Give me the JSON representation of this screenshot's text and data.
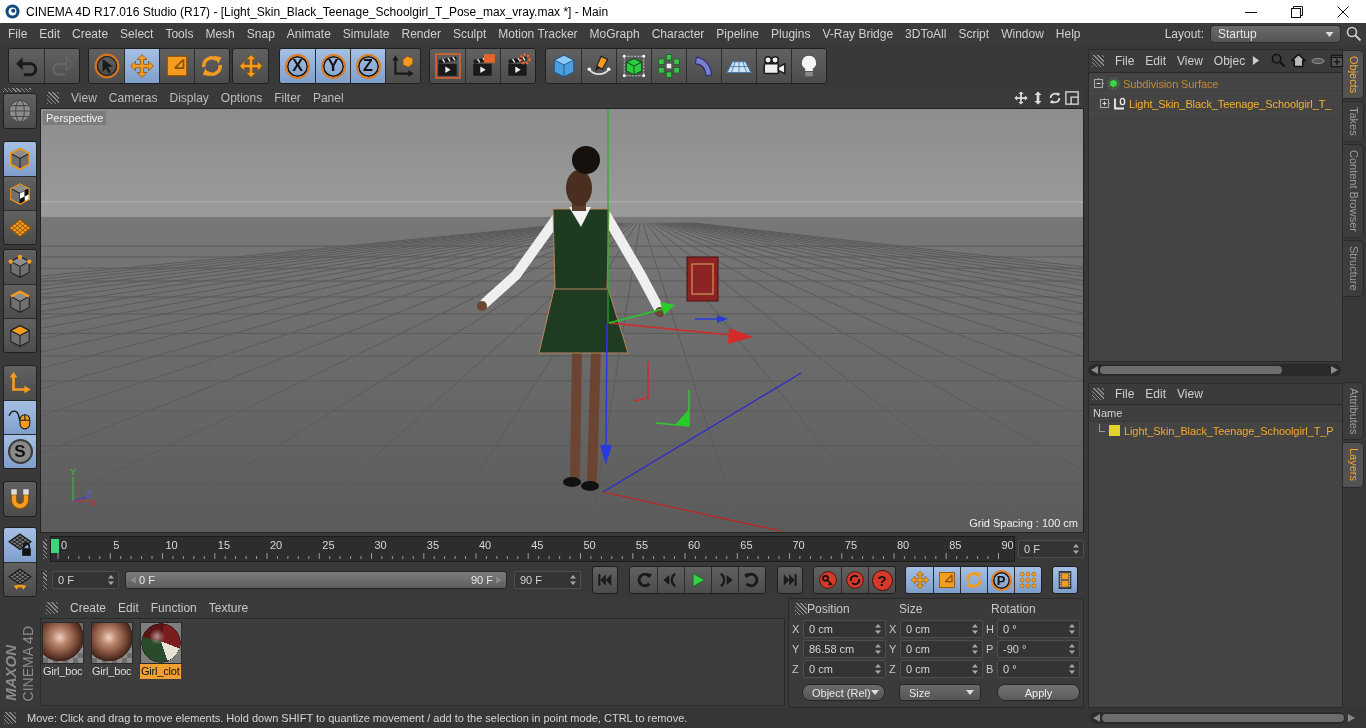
{
  "window": {
    "title": "CINEMA 4D R17.016 Studio (R17) - [Light_Skin_Black_Teenage_Schoolgirl_T_Pose_max_vray.max *] - Main"
  },
  "menu_bar": {
    "items": [
      "File",
      "Edit",
      "Create",
      "Select",
      "Tools",
      "Mesh",
      "Snap",
      "Animate",
      "Simulate",
      "Render",
      "Sculpt",
      "Motion Tracker",
      "MoGraph",
      "Character",
      "Pipeline",
      "Plugins",
      "V-Ray Bridge",
      "3DToAll",
      "Script",
      "Window",
      "Help"
    ],
    "layout_label": "Layout:",
    "layout": "Startup"
  },
  "toolbar": {
    "groups": [
      {
        "tools": [
          {
            "selected": false,
            "disabled": false
          },
          {
            "selected": false,
            "disabled": true
          }
        ]
      },
      {
        "tools": [
          {
            "selected": false,
            "disabled": false
          },
          {
            "selected": true,
            "disabled": false
          },
          {
            "selected": false,
            "disabled": false
          },
          {
            "selected": false,
            "disabled": false
          }
        ]
      },
      {
        "tools": [
          {
            "selected": false,
            "disabled": false
          }
        ]
      },
      {
        "tools": [
          {
            "label": "X",
            "selected": true,
            "disabled": false
          },
          {
            "label": "Y",
            "selected": true,
            "disabled": false
          },
          {
            "label": "Z",
            "selected": true,
            "disabled": false
          },
          {
            "selected": false,
            "disabled": false
          }
        ]
      },
      {
        "tools": [
          {
            "selected": false,
            "disabled": false
          },
          {
            "selected": false,
            "disabled": false
          },
          {
            "selected": false,
            "disabled": false
          }
        ]
      },
      {
        "tools": [
          {
            "selected": false,
            "disabled": false
          },
          {
            "selected": false,
            "disabled": false
          },
          {
            "selected": false,
            "disabled": false
          },
          {
            "selected": false,
            "disabled": false
          },
          {
            "selected": false,
            "disabled": false
          },
          {
            "selected": false,
            "disabled": false
          },
          {
            "selected": false,
            "disabled": false
          },
          {
            "selected": false,
            "disabled": false
          }
        ]
      }
    ]
  },
  "mode_toolbar": {
    "groups": [
      {
        "tools": [
          {
            "selected": false
          }
        ]
      },
      {
        "tools": [
          {
            "selected": true
          },
          {
            "selected": false
          },
          {
            "selected": false
          }
        ]
      },
      {
        "tools": [
          {
            "selected": false
          },
          {
            "selected": false
          },
          {
            "selected": false
          }
        ]
      },
      {
        "tools": [
          {
            "selected": false
          },
          {
            "selected": true
          },
          {
            "label": "S",
            "selected": true
          }
        ]
      },
      {
        "tools": [
          {
            "selected": false
          }
        ]
      },
      {
        "tools": [
          {
            "selected": true
          },
          {
            "selected": false
          }
        ]
      }
    ]
  },
  "logo": {
    "brand": "MAXON",
    "product": "CINEMA 4D"
  },
  "viewport": {
    "menu": [
      "View",
      "Cameras",
      "Display",
      "Options",
      "Filter",
      "Panel"
    ],
    "camera": "Perspective",
    "grid_spacing": "Grid Spacing : 100 cm",
    "axis_labels": [
      "Y",
      "Z",
      "X"
    ]
  },
  "timeline": {
    "frame_labels": [
      "0",
      "5",
      "10",
      "15",
      "20",
      "25",
      "30",
      "35",
      "40",
      "45",
      "50",
      "55",
      "60",
      "65",
      "70",
      "75",
      "80",
      "85",
      "90"
    ],
    "level": 0,
    "current_frame": "0 F"
  },
  "playback": {
    "start_frame": "0 F",
    "range": {
      "start": "0 F",
      "end": "90 F"
    },
    "end_frame": "90 F",
    "groups": [
      {
        "tools": [
          {
            "selected": false
          }
        ]
      },
      {
        "tools": [
          {
            "selected": false
          },
          {
            "selected": false
          },
          {
            "selected": false
          },
          {
            "selected": false
          },
          {
            "selected": false
          }
        ]
      },
      {
        "tools": [
          {
            "selected": false
          }
        ]
      },
      {
        "tools": [
          {
            "selected": false
          },
          {
            "selected": false
          },
          {
            "label": "?",
            "selected": false
          }
        ]
      },
      {
        "tools": [
          {
            "selected": true
          },
          {
            "selected": true
          },
          {
            "selected": true
          },
          {
            "label": "P",
            "selected": true
          },
          {
            "selected": true
          }
        ]
      },
      {
        "tools": [
          {
            "selected": true
          }
        ]
      }
    ]
  },
  "material_manager": {
    "menu": [
      "Create",
      "Edit",
      "Function",
      "Texture"
    ],
    "materials": [
      {
        "name": "Girl_boc",
        "selected": false
      },
      {
        "name": "Girl_boc",
        "selected": false
      },
      {
        "name": "Girl_clot",
        "selected": true
      }
    ]
  },
  "coordinates": {
    "headers": [
      "Position",
      "Size",
      "Rotation"
    ],
    "rows": [
      {
        "cells": [
          {
            "axis": "X",
            "value": "0 cm"
          },
          {
            "axis": "X",
            "value": "0 cm"
          },
          {
            "axis": "H",
            "value": "0 °"
          }
        ]
      },
      {
        "cells": [
          {
            "axis": "Y",
            "value": "86.58 cm"
          },
          {
            "axis": "Y",
            "value": "0 cm"
          },
          {
            "axis": "P",
            "value": "-90 °"
          }
        ]
      },
      {
        "cells": [
          {
            "axis": "Z",
            "value": "0 cm"
          },
          {
            "axis": "Z",
            "value": "0 cm"
          },
          {
            "axis": "B",
            "value": "0 °"
          }
        ]
      }
    ],
    "mode": "Object (Rel)",
    "size_mode": "Size",
    "apply": "Apply"
  },
  "object_manager": {
    "menu": [
      "File",
      "Edit",
      "View",
      "Objec"
    ],
    "objects": [
      {
        "name": "Subdivision Surface",
        "selected": false,
        "expanded": true,
        "children": [
          {
            "name": "Light_Skin_Black_Teenage_Schoolgirl_T_",
            "selected": true,
            "expanded": false
          }
        ]
      }
    ]
  },
  "object_tabs": [
    {
      "label": "Objects",
      "selected": true
    },
    {
      "label": "Takes",
      "selected": false
    },
    {
      "label": "Content Browser",
      "selected": false
    },
    {
      "label": "Structure",
      "selected": false
    }
  ],
  "layer_manager": {
    "menu": [
      "File",
      "Edit",
      "View"
    ],
    "column": "Name",
    "layers": [
      {
        "name": "Light_Skin_Black_Teenage_Schoolgirl_T_P",
        "color": "#e2d52a"
      }
    ]
  },
  "attribute_tabs": [
    {
      "label": "Attributes",
      "selected": false
    },
    {
      "label": "Layers",
      "selected": true
    }
  ],
  "status_bar": {
    "text": "Move: Click and drag to move elements. Hold down SHIFT to quantize movement / add to the selection in point mode, CTRL to remove."
  }
}
